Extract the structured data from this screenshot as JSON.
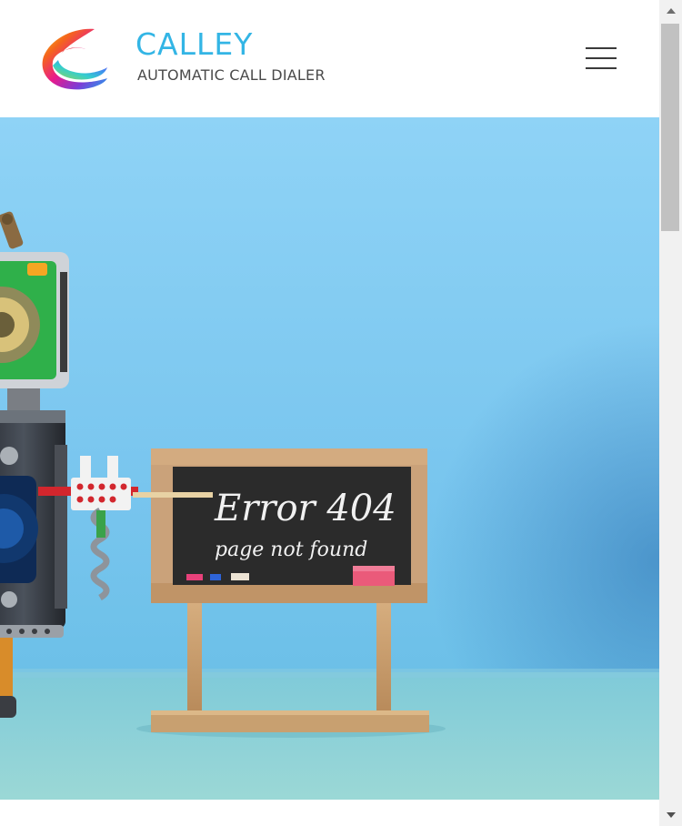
{
  "header": {
    "brand_name": "CALLEY",
    "tagline": "AUTOMATIC CALL DIALER",
    "logo_icon": "calley-swoosh-logo",
    "menu_icon": "hamburger-menu-icon"
  },
  "hero": {
    "chalkboard_line1": "Error 404",
    "chalkboard_line2": "page not found"
  },
  "colors": {
    "brand_blue": "#33b5e5",
    "tagline_gray": "#4a4a4a",
    "sky_blue": "#7fc8ee",
    "floor_teal": "#8fd2d6",
    "chalkboard": "#2a2a2a",
    "wood": "#c9a173"
  },
  "scrollbar": {
    "up_icon": "scroll-up-arrow-icon",
    "down_icon": "scroll-down-arrow-icon"
  }
}
